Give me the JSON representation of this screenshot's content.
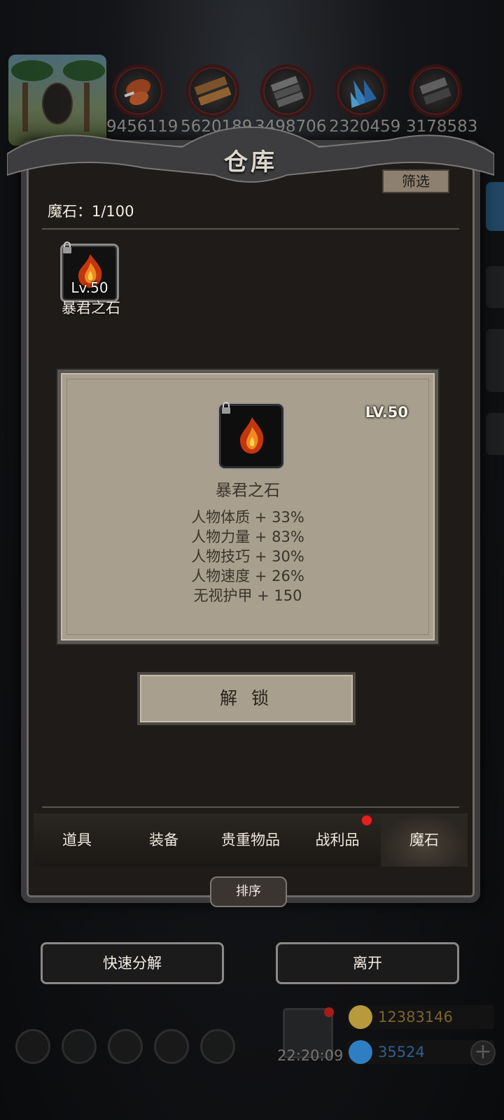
{
  "resources": [
    {
      "icon": "meat-icon",
      "value": "9456119"
    },
    {
      "icon": "wood-icon",
      "value": "5620189"
    },
    {
      "icon": "stone-icon",
      "value": "3498706"
    },
    {
      "icon": "crystal-icon",
      "value": "2320459"
    },
    {
      "icon": "iron-icon",
      "value": "3178583"
    }
  ],
  "warehouse": {
    "title": "仓库",
    "filter_label": "筛选",
    "count_label": "魔石：1/100"
  },
  "item": {
    "level": "Lv.50",
    "name": "暴君之石",
    "icon": "fire-stone-icon",
    "locked": true
  },
  "detail": {
    "level": "LV.50",
    "name": "暴君之石",
    "stats": [
      "人物体质 + 33%",
      "人物力量 + 83%",
      "人物技巧 + 30%",
      "人物速度 + 26%",
      "无视护甲 + 150"
    ],
    "unlock_label": "解 锁"
  },
  "tabs": [
    {
      "label": "道具",
      "active": false,
      "badge": false
    },
    {
      "label": "装备",
      "active": false,
      "badge": false
    },
    {
      "label": "贵重物品",
      "active": false,
      "badge": false
    },
    {
      "label": "战利品",
      "active": false,
      "badge": true
    },
    {
      "label": "魔石",
      "active": true,
      "badge": false
    }
  ],
  "sort_label": "排序",
  "actions": {
    "quick_decompose": "快速分解",
    "leave": "离开"
  },
  "hud": {
    "time": "22:20:09",
    "gold": "12383146",
    "gems": "35524"
  },
  "colors": {
    "badge": "#e0221e",
    "gold_text": "#7a6430",
    "gem_text": "#2f5f8f"
  }
}
